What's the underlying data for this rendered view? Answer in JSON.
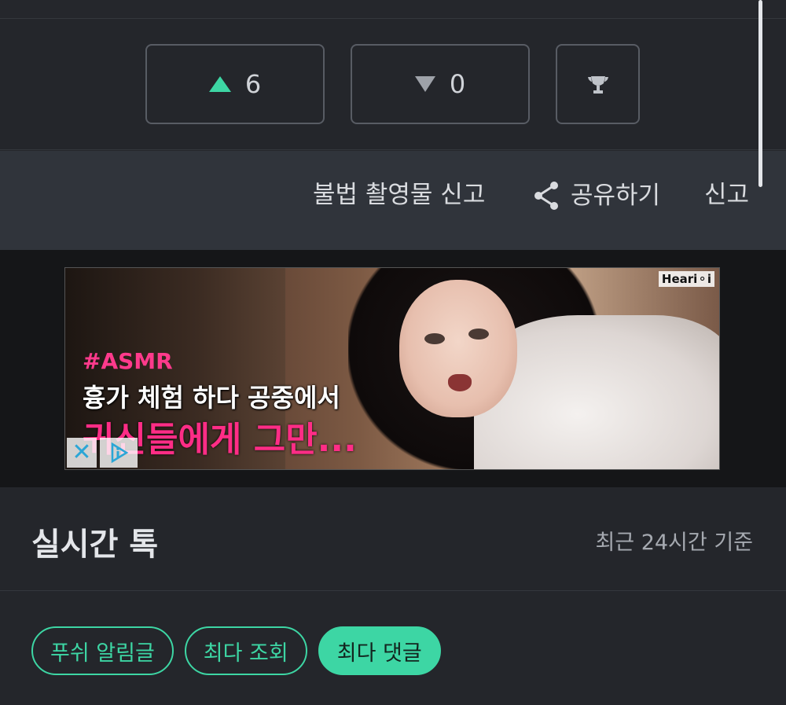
{
  "votes": {
    "up_count": "6",
    "down_count": "0"
  },
  "actions": {
    "illegal_report": "불법 촬영물 신고",
    "share": "공유하기",
    "report": "신고"
  },
  "ad": {
    "brand": "Heari⚬i",
    "tag": "#ASMR",
    "line1": "흉가 체험 하다 공중에서",
    "line2": "귀신들에게 그만...",
    "close_glyph": "✕"
  },
  "section": {
    "title": "실시간 톡",
    "subtitle": "최근 24시간 기준"
  },
  "tabs": [
    {
      "label": "푸쉬 알림글",
      "active": false
    },
    {
      "label": "최다 조회",
      "active": false
    },
    {
      "label": "최다 댓글",
      "active": true
    }
  ],
  "colors": {
    "accent": "#3dd6a4",
    "background": "#24262b",
    "action_bar": "#30343b"
  }
}
